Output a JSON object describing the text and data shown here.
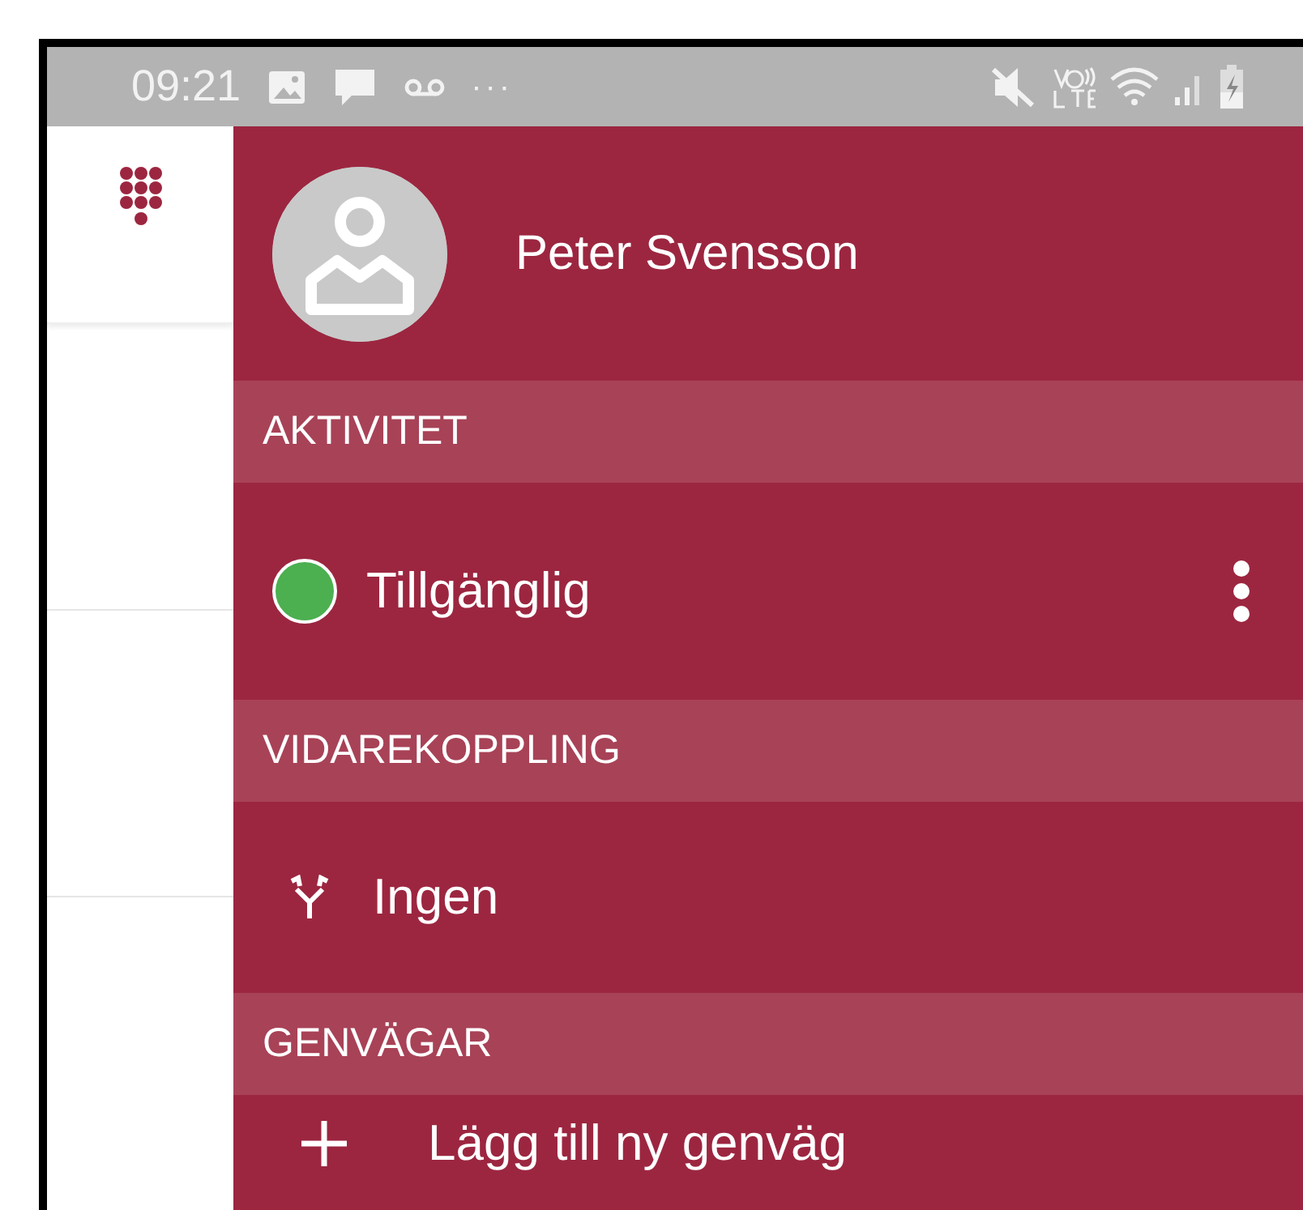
{
  "status_bar": {
    "time": "09:21",
    "more": "···"
  },
  "drawer": {
    "user_name": "Peter Svensson",
    "sections": [
      {
        "title": "AKTIVITET",
        "items": [
          {
            "kind": "status",
            "label": "Tillgänglig",
            "color": "#4caf50"
          }
        ]
      },
      {
        "title": "VIDAREKOPPLING",
        "items": [
          {
            "kind": "forward",
            "label": "Ingen"
          }
        ]
      },
      {
        "title": "GENVÄGAR",
        "items": [
          {
            "kind": "add",
            "label": "Lägg till ny genväg"
          }
        ]
      }
    ]
  }
}
